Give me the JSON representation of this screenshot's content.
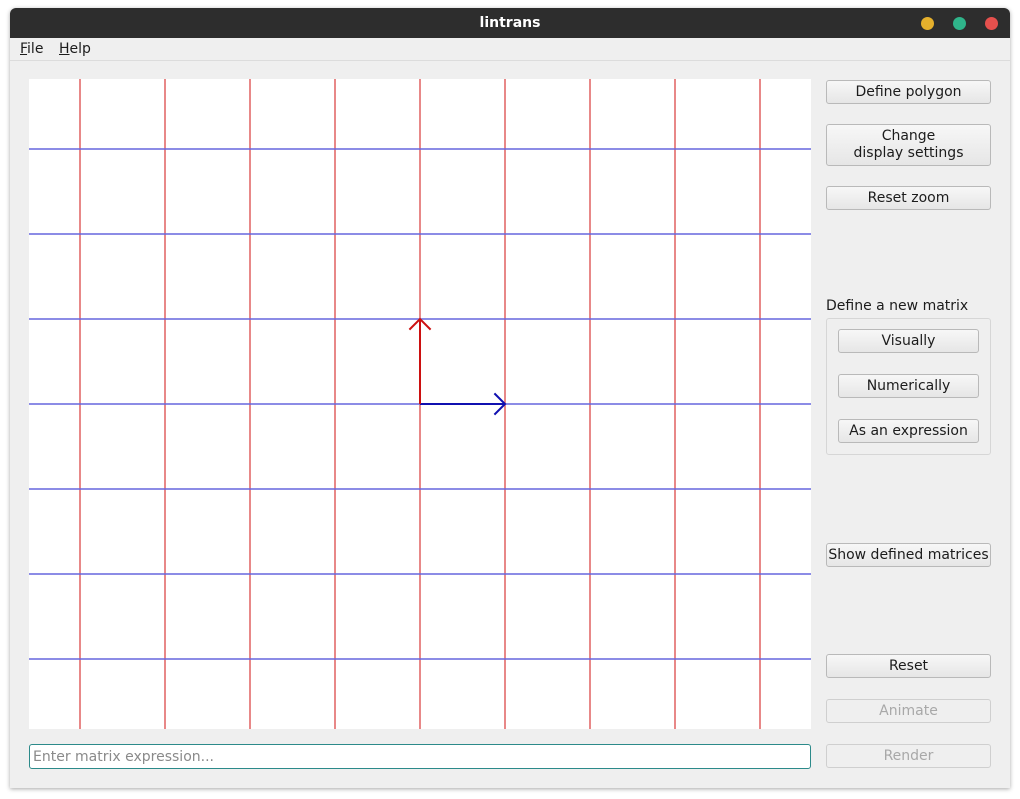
{
  "window": {
    "title": "lintrans",
    "controls": [
      {
        "name": "minimize",
        "color": "#e5b02c"
      },
      {
        "name": "maximize",
        "color": "#2fb48a"
      },
      {
        "name": "close",
        "color": "#e5504d"
      }
    ]
  },
  "menu": {
    "file": {
      "mnemonic": "F",
      "rest": "ile"
    },
    "help": {
      "mnemonic": "H",
      "rest": "elp"
    }
  },
  "plot": {
    "grid_spacing_units": 1,
    "vertical_line_color": "#e06060",
    "horizontal_line_color": "#6666dd",
    "basis_i": {
      "vector": [
        1,
        0
      ],
      "color": "#1010b0"
    },
    "basis_j": {
      "vector": [
        0,
        1
      ],
      "color": "#cc1010"
    }
  },
  "sidebar": {
    "define_polygon": "Define polygon",
    "change_display_line1": "Change",
    "change_display_line2": "display settings",
    "reset_zoom": "Reset zoom",
    "define_matrix_label": "Define a new matrix",
    "visually": "Visually",
    "numerically": "Numerically",
    "as_expression": "As an expression",
    "show_defined": "Show defined matrices",
    "reset": "Reset",
    "animate": "Animate",
    "render": "Render"
  },
  "expression": {
    "value": "",
    "placeholder": "Enter matrix expression..."
  }
}
